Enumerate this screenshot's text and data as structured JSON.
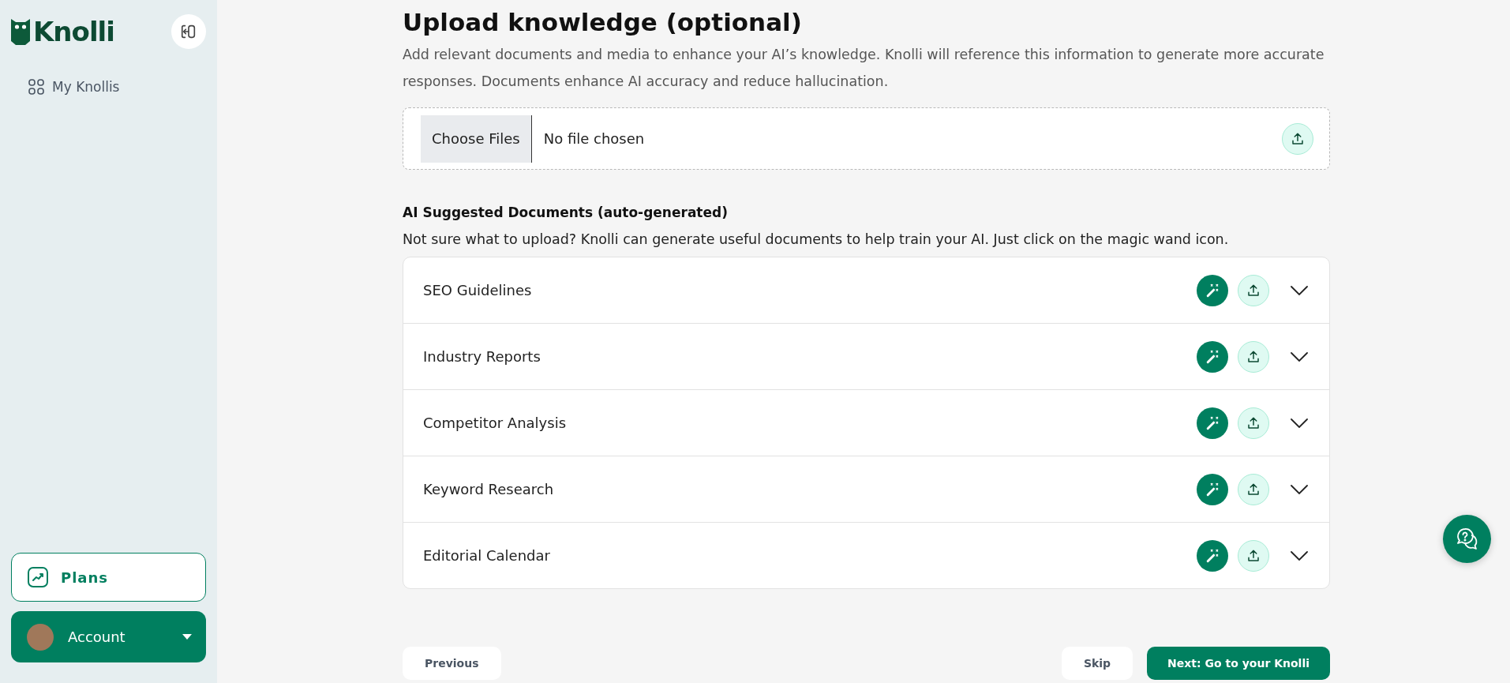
{
  "sidebar": {
    "logo": "Knolli",
    "nav": [
      {
        "label": "My Knollis",
        "selected": false
      }
    ],
    "plans": "Plans",
    "account": "Account"
  },
  "upload": {
    "title": "Upload knowledge (optional)",
    "description": "Add relevant documents and media to enhance your AI’s knowledge. Knolli will reference this information to generate more accurate responses. Documents enhance AI accuracy and reduce hallucination.",
    "choose_button": "Choose Files",
    "file_status": "No file chosen"
  },
  "suggested": {
    "heading": "AI Suggested Documents (auto-generated)",
    "hint": "Not sure what to upload? Knolli can generate useful documents to help train your AI. Just click on the magic wand icon.",
    "documents": [
      {
        "name": "SEO Guidelines",
        "expanded": false
      },
      {
        "name": "Industry Reports",
        "expanded": false
      },
      {
        "name": "Competitor Analysis",
        "expanded": false
      },
      {
        "name": "Keyword Research",
        "expanded": false
      },
      {
        "name": "Editorial Calendar",
        "expanded": false
      }
    ]
  },
  "footer": {
    "previous": "Previous",
    "skip": "Skip",
    "next": "Next: Go to your Knolli"
  }
}
